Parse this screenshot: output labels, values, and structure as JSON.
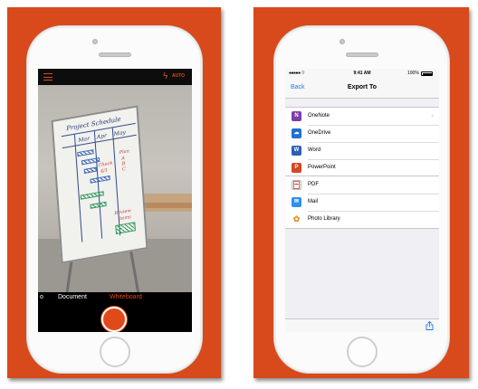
{
  "colors": {
    "brand": "#d84a1b",
    "accent_orange": "#e04a1a",
    "ios_blue": "#1a7cf0",
    "onenote": "#7b3ea8",
    "onedrive": "#1f6fd6",
    "word": "#2b5fb4",
    "powerpoint": "#d24726",
    "pdf": "#e0e0e0",
    "mail": "#2f8ff0"
  },
  "lens_screen": {
    "flash_label": "AUTO",
    "modes": [
      "o",
      "Document",
      "Whiteboard"
    ],
    "active_mode": "Whiteboard",
    "icons": [
      "menu-icon",
      "flash-icon",
      "shutter-button"
    ],
    "whiteboard": {
      "title": "Project Schedule",
      "months": "Mar Apr May",
      "notes": [
        "Check",
        "4/1",
        "Plan",
        "A",
        "B",
        "C",
        "Review",
        "items"
      ]
    }
  },
  "export_screen": {
    "status": {
      "time": "9:41 AM",
      "battery": "100%"
    },
    "nav": {
      "back": "Back",
      "title": "Export To"
    },
    "apps": [
      {
        "label": "OneNote",
        "icon": "onenote-icon",
        "glyph": "N"
      },
      {
        "label": "OneDrive",
        "icon": "onedrive-icon",
        "glyph": "☁"
      },
      {
        "label": "Word",
        "icon": "word-icon",
        "glyph": "W"
      },
      {
        "label": "PowerPoint",
        "icon": "powerpoint-icon",
        "glyph": "P"
      }
    ],
    "other": [
      {
        "label": "PDF",
        "icon": "pdf-icon",
        "glyph": ""
      },
      {
        "label": "Mail",
        "icon": "mail-icon",
        "glyph": "✉"
      },
      {
        "label": "Photo Library",
        "icon": "photo-library-icon",
        "glyph": "✿"
      }
    ]
  }
}
